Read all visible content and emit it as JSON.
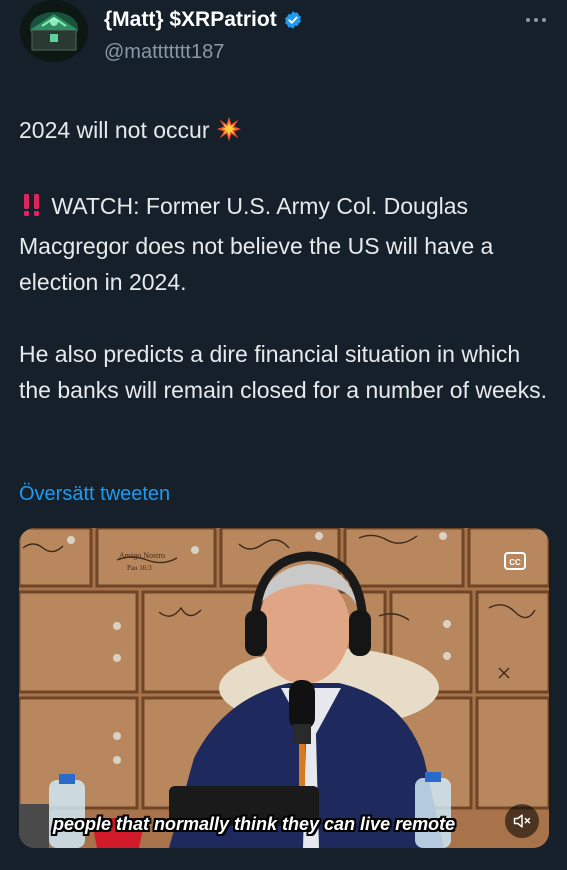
{
  "author": {
    "display_name": "{Matt} $XRPatriot",
    "handle": "@mattttttt187",
    "verified": true,
    "avatar_icon": "avatar-green-chest"
  },
  "menu": {
    "icon": "more-horizontal-icon"
  },
  "tweet": {
    "line1": "2024 will not occur",
    "para2": "WATCH: Former U.S. Army Col. Douglas Macgregor does not believe the US will have a election in 2024.",
    "para3": "He also predicts a dire financial situation in which the banks will remain closed for a number of weeks."
  },
  "translate_label": "Översätt tweeten",
  "video": {
    "subtitle": "people that normally think they can live remote",
    "cc_icon": "closed-captions-icon",
    "mute_icon": "muted-speaker-icon"
  },
  "colors": {
    "background": "#15202b",
    "link": "#1d9bf0",
    "verified": "#1d9bf0",
    "secondary_text": "#8b98a5"
  }
}
